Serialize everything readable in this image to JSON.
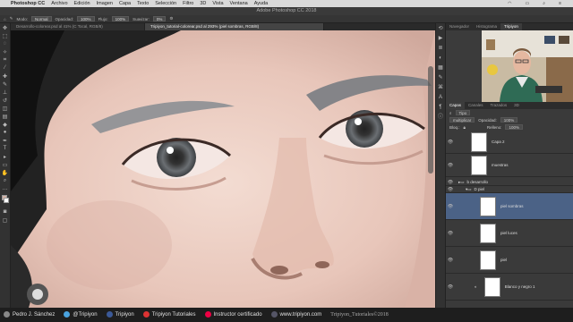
{
  "menubar": {
    "app": "Photoshop CC",
    "items": [
      "Archivo",
      "Edición",
      "Imagen",
      "Capa",
      "Texto",
      "Selección",
      "Filtro",
      "3D",
      "Vista",
      "Ventana",
      "Ayuda"
    ]
  },
  "window_title": "Adobe Photoshop CC 2018",
  "options": {
    "mode_label": "Modo:",
    "mode_value": "Normal",
    "opacity_label": "Opacidad:",
    "opacity_value": "100%",
    "flow_label": "Flujo:",
    "flow_value": "100%",
    "smooth_label": "Suavizar:",
    "smooth_value": "0%"
  },
  "doc_tabs": [
    "Desarrollo-colorear.psd al 41% (C Tocal, RGB/8)",
    "Tripiyon_tutorial-colorear.psd al 293% (piel sombras, RGB/8)"
  ],
  "right_panel_tabs": [
    "Navegador",
    "Histograma",
    "Tripiyon"
  ],
  "layers_panel": {
    "tabs": [
      "Capas",
      "Canales",
      "Trazados",
      "3D"
    ],
    "filter_label": "Tipo",
    "blend_mode": "multiplicar",
    "opacity_label": "Opacidad:",
    "opacity_value": "100%",
    "lock_label": "Bloq.:",
    "fill_label": "Relleno:",
    "fill_value": "100%",
    "layers": [
      {
        "name": "Capa 2",
        "selected": false
      },
      {
        "name": "muestras",
        "selected": false
      },
      {
        "name": "piel sombras",
        "selected": true
      },
      {
        "name": "piel luces",
        "selected": false
      },
      {
        "name": "piel",
        "selected": false
      },
      {
        "name": "Blanco y negro 1",
        "selected": false
      }
    ],
    "groups": [
      "b desarrollo",
      "D piel"
    ]
  },
  "footer": {
    "items": [
      "Pedro J. Sánchez",
      "@Tripiyon",
      "Tripiyon",
      "Tripiyon Tutoriales",
      "Instructor certificado",
      "www.tripiyon.com",
      "Tripiyon_Tutoriales©2018"
    ]
  },
  "colors": {
    "accent_selected_layer": "#4b6286",
    "canvas_skin": "#e6c7bd"
  }
}
